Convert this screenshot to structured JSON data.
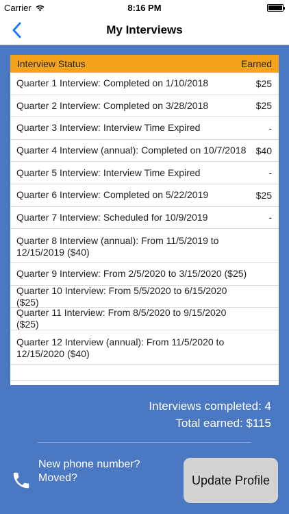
{
  "status_bar": {
    "carrier": "Carrier",
    "time": "8:16 PM",
    "wifi_icon": "wifi-icon",
    "battery_icon": "battery-icon"
  },
  "nav": {
    "title": "My Interviews",
    "back_icon": "chevron-left-icon"
  },
  "table": {
    "header_status": "Interview Status",
    "header_earned": "Earned",
    "rows": [
      {
        "status": "Quarter 1 Interview: Completed on 1/10/2018",
        "earned": "$25"
      },
      {
        "status": "Quarter 2 Interview: Completed on 3/28/2018",
        "earned": "$25"
      },
      {
        "status": "Quarter 3 Interview: Interview Time Expired",
        "earned": "-"
      },
      {
        "status": "Quarter 4 Interview (annual): Completed on 10/7/2018",
        "earned": "$40"
      },
      {
        "status": "Quarter 5 Interview: Interview Time Expired",
        "earned": "-"
      },
      {
        "status": "Quarter 6 Interview: Completed on 5/22/2019",
        "earned": "$25"
      },
      {
        "status": "Quarter 7 Interview: Scheduled for 10/9/2019",
        "earned": "-"
      },
      {
        "status": "Quarter 8 Interview (annual): From 11/5/2019 to 12/15/2019 ($40)",
        "earned": ""
      },
      {
        "status": "Quarter 9 Interview: From 2/5/2020 to 3/15/2020 ($25)",
        "earned": ""
      },
      {
        "status": "Quarter 10 Interview: From 5/5/2020 to 6/15/2020 ($25)",
        "earned": ""
      },
      {
        "status": "Quarter 11 Interview: From 8/5/2020 to 9/15/2020 ($25)",
        "earned": ""
      },
      {
        "status": "Quarter 12 Interview (annual): From 11/5/2020 to 12/15/2020 ($40)",
        "earned": ""
      }
    ]
  },
  "summary": {
    "completed": "Interviews completed: 4",
    "total": "Total earned: $115"
  },
  "footer": {
    "phone_icon": "phone-icon",
    "prompt": "New phone number? Moved?",
    "update_label": "Update Profile"
  },
  "colors": {
    "background": "#4a78c2",
    "header": "#f5a31a",
    "back_chevron": "#1a7cf5"
  }
}
